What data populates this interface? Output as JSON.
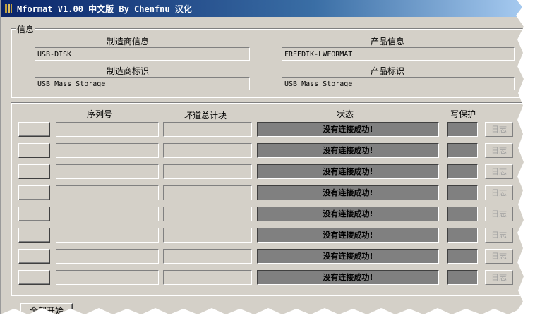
{
  "window": {
    "title": "Mformat V1.00 中文版 By Chenfnu 汉化"
  },
  "info": {
    "group_title": "信息",
    "vendor_info_label": "制造商信息",
    "vendor_info_value": "USB-DISK",
    "product_info_label": "产品信息",
    "product_info_value": "FREEDIK-LWFORMAT",
    "vendor_id_label": "制造商标识",
    "vendor_id_value": "USB Mass Storage",
    "product_id_label": "产品标识",
    "product_id_value": "USB Mass Storage"
  },
  "table": {
    "headers": {
      "serial": "序列号",
      "bad_blocks": "坏道总计块",
      "status": "状态",
      "write_protect": "写保护"
    },
    "rows": [
      {
        "status": "没有连接成功!",
        "log": "日志"
      },
      {
        "status": "没有连接成功!",
        "log": "日志"
      },
      {
        "status": "没有连接成功!",
        "log": "日志"
      },
      {
        "status": "没有连接成功!",
        "log": "日志"
      },
      {
        "status": "没有连接成功!",
        "log": "日志"
      },
      {
        "status": "没有连接成功!",
        "log": "日志"
      },
      {
        "status": "没有连接成功!",
        "log": "日志"
      },
      {
        "status": "没有连接成功!",
        "log": "日志"
      }
    ]
  },
  "footer": {
    "start_all_label": "全部开始"
  },
  "icons": {
    "app": "app-icon"
  }
}
